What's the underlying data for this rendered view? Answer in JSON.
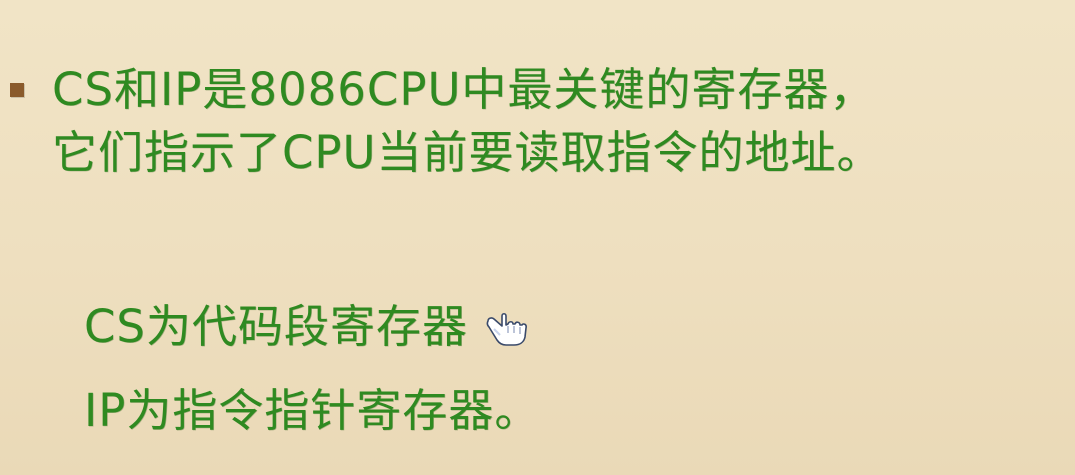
{
  "slide": {
    "bullet": {
      "line1": "CS和IP是8086CPU中最关键的寄存器，",
      "line2": "它们指示了CPU当前要读取指令的地址。"
    },
    "sub": {
      "line1": "CS为代码段寄存器",
      "line2": "IP为指令指针寄存器。"
    },
    "icons": {
      "bullet": "square-bullet-icon",
      "cursor": "hand-pointer-icon"
    },
    "colors": {
      "background": "#efe1c1",
      "text": "#2f8a21",
      "bullet": "#8a5a2b"
    }
  }
}
